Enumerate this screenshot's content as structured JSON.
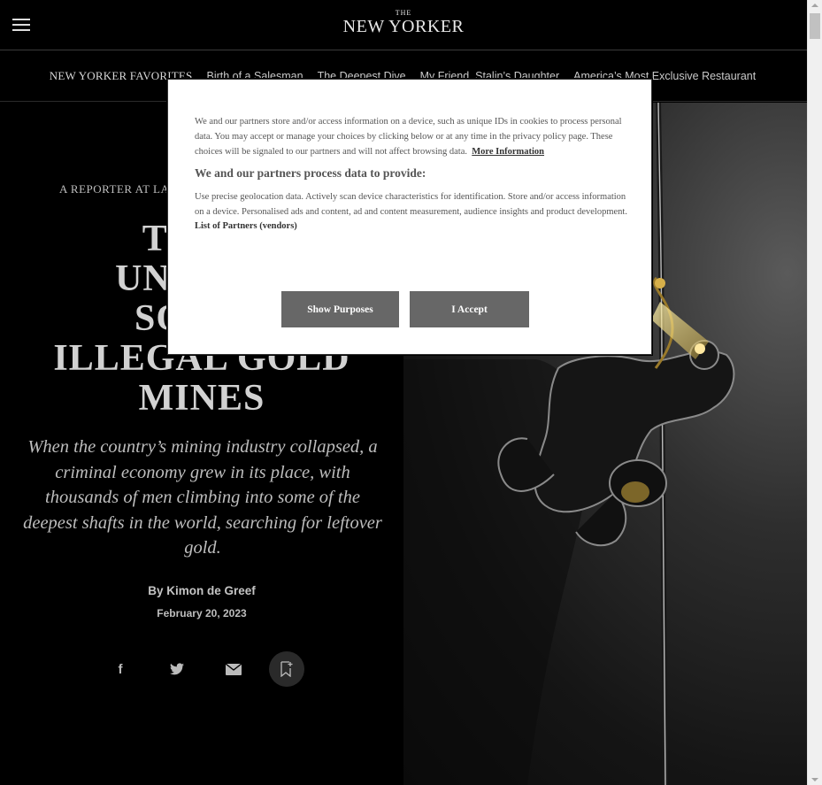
{
  "header": {
    "logo_the": "THE",
    "logo_name": "NEW YORKER"
  },
  "favorites": {
    "heading": "NEW YORKER FAVORITES",
    "items": [
      "Birth of a Salesman",
      "The Deepest Dive",
      "My Friend, Stalin’s Daughter",
      "America’s Most Exclusive Restaurant"
    ]
  },
  "article": {
    "rubric": "A REPORTER AT LA",
    "headline_lines": [
      "THE D",
      "UNDERW",
      "SOUTH",
      "ILLEGAL GOLD",
      "MINES"
    ],
    "dek": "When the country’s mining industry collapsed, a criminal economy grew in its place, with thousands of men climbing into some of the deepest shafts in the world, searching for leftover gold.",
    "byline": "By Kimon de Greef",
    "date": "February 20, 2023"
  },
  "share": {
    "icons": [
      "facebook-icon",
      "twitter-icon",
      "email-icon",
      "bookmark-icon"
    ],
    "facebook_glyph": "f"
  },
  "consent": {
    "intro": "We and our partners store and/or access information on a device, such as unique IDs in cookies to process personal data. You may accept or manage your choices by clicking below or at any time in the privacy policy page. These choices will be signaled to our partners and will not affect browsing data.",
    "more_info_link": "More Information",
    "purposes_heading": "We and our partners process data to provide:",
    "purposes_text": "Use precise geolocation data. Actively scan device characteristics for identification. Store and/or access information on a device. Personalised ads and content, ad and content measurement, audience insights and product development.",
    "vendors_link": "List of Partners (vendors)",
    "show_purposes_label": "Show Purposes",
    "accept_label": "I Accept"
  },
  "colors": {
    "page_bg": "#000000",
    "dialog_bg": "#ffffff",
    "button_bg": "#676767",
    "lamp_glow": "#e8c24a"
  }
}
